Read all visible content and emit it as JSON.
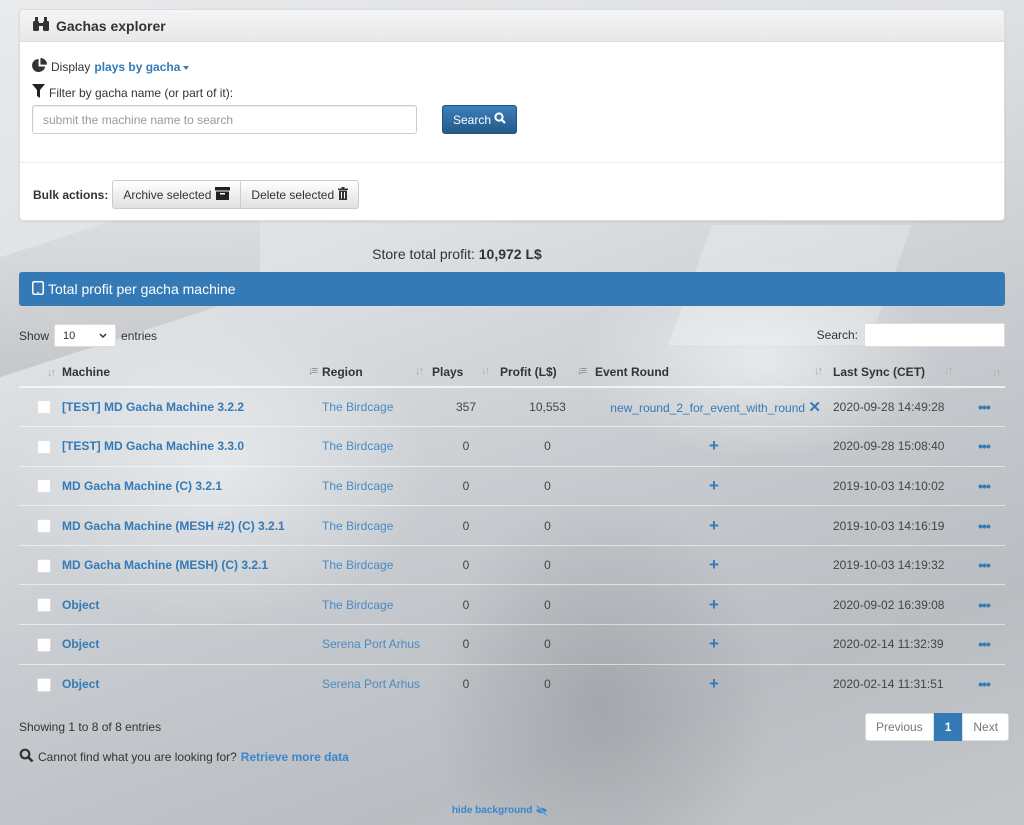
{
  "panel": {
    "title": "Gachas explorer",
    "display_label": "Display",
    "display_value": "plays by gacha",
    "filter_label": "Filter by gacha name (or part of it):",
    "search_placeholder": "submit the machine name to search",
    "search_value": "",
    "search_button": "Search",
    "bulk_label": "Bulk actions:",
    "archive_button": "Archive selected",
    "delete_button": "Delete selected"
  },
  "summary": {
    "total_label": "Store total profit:",
    "total_value": "10,972 L$"
  },
  "table_panel": {
    "title": "Total profit per gacha machine"
  },
  "datatable": {
    "show_label": "Show",
    "entries_label": "entries",
    "page_length": "10",
    "search_label": "Search:",
    "search_value": "",
    "columns": [
      "",
      "Machine",
      "Region",
      "Plays",
      "Profit (L$)",
      "Event Round",
      "Last Sync (CET)",
      ""
    ],
    "rows": [
      {
        "machine": "[TEST] MD Gacha Machine 3.2.2",
        "region": "The Birdcage",
        "plays": "357",
        "profit": "10,553",
        "event_round": "new_round_2_for_event_with_round",
        "last_sync": "2020-09-28 14:49:28"
      },
      {
        "machine": "[TEST] MD Gacha Machine 3.3.0",
        "region": "The Birdcage",
        "plays": "0",
        "profit": "0",
        "event_round": "",
        "last_sync": "2020-09-28 15:08:40"
      },
      {
        "machine": "MD Gacha Machine (C) 3.2.1",
        "region": "The Birdcage",
        "plays": "0",
        "profit": "0",
        "event_round": "",
        "last_sync": "2019-10-03 14:10:02"
      },
      {
        "machine": "MD Gacha Machine (MESH #2) (C) 3.2.1",
        "region": "The Birdcage",
        "plays": "0",
        "profit": "0",
        "event_round": "",
        "last_sync": "2019-10-03 14:16:19"
      },
      {
        "machine": "MD Gacha Machine (MESH) (C) 3.2.1",
        "region": "The Birdcage",
        "plays": "0",
        "profit": "0",
        "event_round": "",
        "last_sync": "2019-10-03 14:19:32"
      },
      {
        "machine": "Object",
        "region": "The Birdcage",
        "plays": "0",
        "profit": "0",
        "event_round": "",
        "last_sync": "2020-09-02 16:39:08"
      },
      {
        "machine": "Object",
        "region": "Serena Port Arhus",
        "plays": "0",
        "profit": "0",
        "event_round": "",
        "last_sync": "2020-02-14 11:32:39"
      },
      {
        "machine": "Object",
        "region": "Serena Port Arhus",
        "plays": "0",
        "profit": "0",
        "event_round": "",
        "last_sync": "2020-02-14 11:31:51"
      }
    ],
    "info": "Showing 1 to 8 of 8 entries",
    "pager": {
      "previous": "Previous",
      "current": "1",
      "next": "Next"
    }
  },
  "footer": {
    "cannot_find": "Cannot find what you are looking for?",
    "retrieve_link": "Retrieve more data",
    "hide_background": "hide background"
  },
  "icons": {
    "binoculars": "binoculars-icon",
    "pie_chart": "pie-chart-icon",
    "filter": "filter-icon",
    "search": "search-icon",
    "archive": "archive-icon",
    "trash": "trash-icon",
    "tablet": "tablet-icon",
    "add": "plus-icon",
    "remove": "x-icon",
    "more": "ellipsis-icon",
    "no_image": "eye-slash-icon"
  },
  "colors": {
    "primary": "#337ab7",
    "link": "#337ab7"
  }
}
